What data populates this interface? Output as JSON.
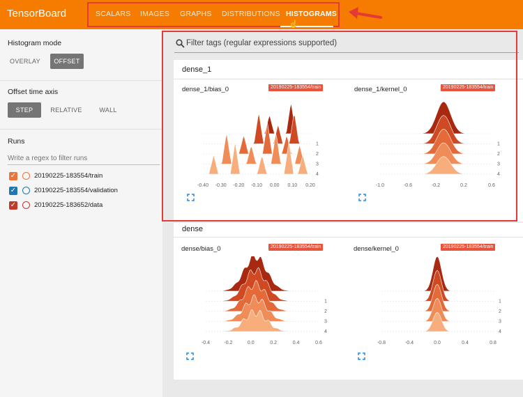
{
  "app": {
    "title": "TensorBoard"
  },
  "nav": {
    "tabs": [
      "SCALARS",
      "IMAGES",
      "GRAPHS",
      "DISTRIBUTIONS",
      "HISTOGRAMS"
    ],
    "active": "HISTOGRAMS"
  },
  "sidebar": {
    "histogram_mode": {
      "title": "Histogram mode",
      "options": [
        "OVERLAY",
        "OFFSET"
      ],
      "selected": "OFFSET"
    },
    "offset_time_axis": {
      "title": "Offset time axis",
      "options": [
        "STEP",
        "RELATIVE",
        "WALL"
      ],
      "selected": "STEP"
    },
    "runs": {
      "title": "Runs",
      "filter_placeholder": "Write a regex to filter runs",
      "items": [
        {
          "name": "20190225-183554/train",
          "checked": true,
          "color": "#e8753a"
        },
        {
          "name": "20190225-183554/validation",
          "checked": true,
          "color": "#1f77b4"
        },
        {
          "name": "20190225-183652/data",
          "checked": true,
          "color": "#c0392b"
        }
      ]
    }
  },
  "main": {
    "filter_placeholder": "Filter tags (regular expressions supported)",
    "groups": [
      {
        "name": "dense_1",
        "cards": [
          {
            "title": "dense_1/bias_0",
            "run": "20190225-183554/train",
            "x_ticks": [
              "-0.40",
              "-0.30",
              "-0.20",
              "-0.10",
              "0.00",
              "0.10",
              "0.20"
            ],
            "y_ticks": [
              "1",
              "2",
              "3",
              "4"
            ]
          },
          {
            "title": "dense_1/kernel_0",
            "run": "20190225-183554/train",
            "x_ticks": [
              "-1.0",
              "-0.6",
              "-0.2",
              "0.2",
              "0.6"
            ],
            "y_ticks": [
              "1",
              "2",
              "3",
              "4"
            ]
          }
        ]
      },
      {
        "name": "dense",
        "cards": [
          {
            "title": "dense/bias_0",
            "run": "20190225-183554/train",
            "x_ticks": [
              "-0.4",
              "-0.2",
              "0.0",
              "0.2",
              "0.4",
              "0.6"
            ],
            "y_ticks": [
              "1",
              "2",
              "3",
              "4"
            ]
          },
          {
            "title": "dense/kernel_0",
            "run": "20190225-183554/train",
            "x_ticks": [
              "-0.8",
              "-0.4",
              "0.0",
              "0.4",
              "0.8"
            ],
            "y_ticks": [
              "1",
              "2",
              "3",
              "4"
            ]
          }
        ]
      }
    ]
  },
  "colors": {
    "accent": "#f57c00",
    "highlight": "#e53935",
    "badge": "#e8533c",
    "histogram_steps": [
      "#a8290f",
      "#cf4a22",
      "#e46a3a",
      "#f08c58",
      "#f7ad7c"
    ]
  },
  "icons": {
    "search": "search-icon",
    "expand": "expand-icon",
    "arrow": "arrow-icon"
  }
}
